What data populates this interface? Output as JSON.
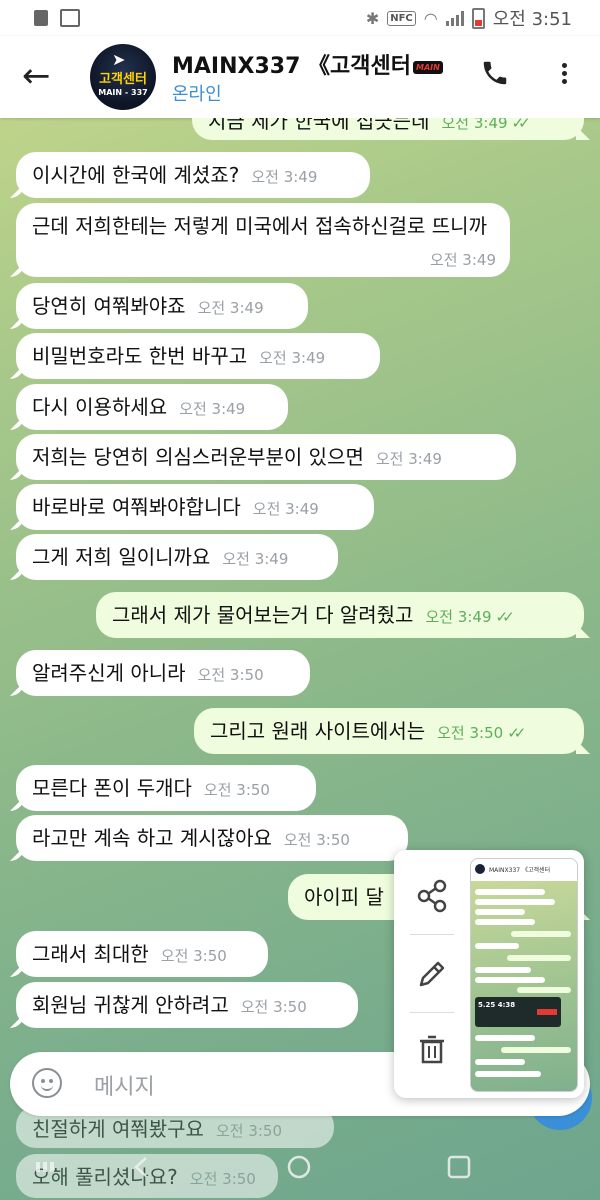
{
  "status_bar": {
    "time": "오전 3:51",
    "nfc_label": "NFC"
  },
  "header": {
    "back_icon": "←",
    "avatar_title": "고객센터",
    "avatar_sub": "MAIN - 337",
    "title": "MAINX337 《고객센터",
    "title_badge": "MAIN",
    "subtitle": "온라인",
    "phone_icon": "phone-icon"
  },
  "messages": [
    {
      "dir": "out",
      "text": "지금 제가 한국에 접긋는데",
      "time": "오전 3:49",
      "read": "✓✓"
    },
    {
      "dir": "in",
      "text": "이시간에 한국에 계셨죠?",
      "time": "오전 3:49"
    },
    {
      "dir": "in",
      "text": "근데 저희한테는 저렇게 미국에서 접속하신걸로 뜨니까",
      "time": "오전 3:49"
    },
    {
      "dir": "in",
      "text": "당연히 여쭤봐야죠",
      "time": "오전 3:49"
    },
    {
      "dir": "in",
      "text": "비밀번호라도 한번 바꾸고",
      "time": "오전 3:49"
    },
    {
      "dir": "in",
      "text": "다시 이용하세요",
      "time": "오전 3:49"
    },
    {
      "dir": "in",
      "text": "저희는 당연히 의심스러운부분이 있으면",
      "time": "오전 3:49"
    },
    {
      "dir": "in",
      "text": "바로바로 여쭤봐야합니다",
      "time": "오전 3:49"
    },
    {
      "dir": "in",
      "text": "그게 저희 일이니까요",
      "time": "오전 3:49"
    },
    {
      "dir": "out",
      "text": "그래서 제가 물어보는거 다 알려줬고",
      "time": "오전 3:49",
      "read": "✓✓"
    },
    {
      "dir": "in",
      "text": "알려주신게 아니라",
      "time": "오전 3:50"
    },
    {
      "dir": "out",
      "text": "그리고 원래 사이트에서는",
      "time": "오전 3:50",
      "read": "✓✓"
    },
    {
      "dir": "in",
      "text": "모른다 폰이 두개다",
      "time": "오전 3:50"
    },
    {
      "dir": "in",
      "text": "라고만 계속 하고 계시잖아요",
      "time": "오전 3:50"
    },
    {
      "dir": "out",
      "text": "아이피 달",
      "time": "",
      "read": ""
    },
    {
      "dir": "in",
      "text": "그래서 최대한",
      "time": "오전 3:50"
    },
    {
      "dir": "in",
      "text": "회원님 귀찮게 안하려고",
      "time": "오전 3:50"
    },
    {
      "dir": "in",
      "text": "친절하게 여쭤봤구요",
      "time": "오전 3:50"
    },
    {
      "dir": "in",
      "text": "오해 풀리셨나요?",
      "time": "오전 3:50"
    }
  ],
  "input": {
    "placeholder": "메시지"
  },
  "screenshot_popup": {
    "share_icon": "share-icon",
    "edit_icon": "pencil-icon",
    "delete_icon": "trash-icon",
    "thumb_title": "MAINX337 《고객센터",
    "thumb_dark_text": "5.25\n4:38"
  },
  "colors": {
    "incoming_bubble": "#ffffff",
    "outgoing_bubble": "#effdde",
    "accent": "#3a8fd6",
    "read_check": "#5fad5b"
  }
}
